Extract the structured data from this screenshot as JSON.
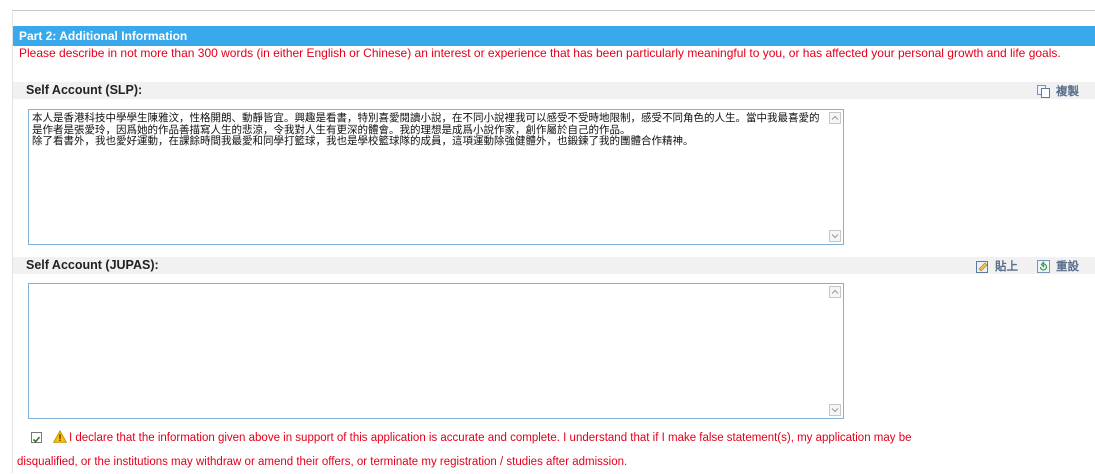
{
  "section": {
    "title": "Part 2: Additional Information",
    "description": "Please describe in not more than 300 words (in either English or Chinese) an interest or experience that has been particularly meaningful to you, or has affected your personal growth and life goals."
  },
  "slp": {
    "label": "Self Account (SLP):",
    "copy_label": "複製",
    "text": "本人是香港科技中學學生陳雅汶，性格開朗、動靜皆宜。興趣是看書，特別喜愛閱讀小說，在不同小說裡我可以感受不受時地限制，感受不同角色的人生。當中我最喜愛的是作者是張愛玲，因爲她的作品善描寫人生的悲涼，令我對人生有更深的體會。我的理想是成爲小說作家，創作屬於自己的作品。\n除了看書外，我也愛好運動，在課餘時間我最愛和同學打籃球，我也是學校籃球隊的成員，這項運動除強健體外，也鍛鍊了我的團體合作精神。"
  },
  "jupas": {
    "label": "Self Account (JUPAS):",
    "paste_label": "貼上",
    "reset_label": "重設",
    "text": ""
  },
  "declaration": {
    "checked": true,
    "line1": "I declare that the information given above in support of this application is accurate and complete. I understand that if I make false statement(s), my application may be",
    "line2": "disqualified, or the institutions may withdraw or amend their offers, or terminate my registration / studies after admission."
  },
  "colors": {
    "header_bg": "#3aa9ec",
    "warning_text": "#e2001a"
  }
}
